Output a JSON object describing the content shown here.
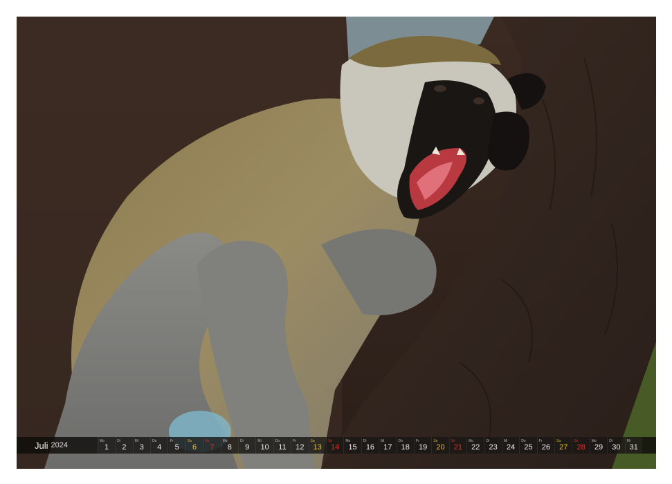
{
  "calendar": {
    "month": "Juli",
    "year": "2024",
    "days": [
      {
        "wd": "Mo",
        "num": "1",
        "kind": ""
      },
      {
        "wd": "Di",
        "num": "2",
        "kind": ""
      },
      {
        "wd": "Mi",
        "num": "3",
        "kind": ""
      },
      {
        "wd": "Do",
        "num": "4",
        "kind": ""
      },
      {
        "wd": "Fr",
        "num": "5",
        "kind": ""
      },
      {
        "wd": "Sa",
        "num": "6",
        "kind": "sa"
      },
      {
        "wd": "So",
        "num": "7",
        "kind": "su"
      },
      {
        "wd": "Mo",
        "num": "8",
        "kind": ""
      },
      {
        "wd": "Di",
        "num": "9",
        "kind": ""
      },
      {
        "wd": "Mi",
        "num": "10",
        "kind": ""
      },
      {
        "wd": "Do",
        "num": "11",
        "kind": ""
      },
      {
        "wd": "Fr",
        "num": "12",
        "kind": ""
      },
      {
        "wd": "Sa",
        "num": "13",
        "kind": "sa"
      },
      {
        "wd": "So",
        "num": "14",
        "kind": "su"
      },
      {
        "wd": "Mo",
        "num": "15",
        "kind": ""
      },
      {
        "wd": "Di",
        "num": "16",
        "kind": ""
      },
      {
        "wd": "Mi",
        "num": "17",
        "kind": ""
      },
      {
        "wd": "Do",
        "num": "18",
        "kind": ""
      },
      {
        "wd": "Fr",
        "num": "19",
        "kind": ""
      },
      {
        "wd": "Sa",
        "num": "20",
        "kind": "sa"
      },
      {
        "wd": "So",
        "num": "21",
        "kind": "su"
      },
      {
        "wd": "Mo",
        "num": "22",
        "kind": ""
      },
      {
        "wd": "Di",
        "num": "23",
        "kind": ""
      },
      {
        "wd": "Mi",
        "num": "24",
        "kind": ""
      },
      {
        "wd": "Do",
        "num": "25",
        "kind": ""
      },
      {
        "wd": "Fr",
        "num": "26",
        "kind": ""
      },
      {
        "wd": "Sa",
        "num": "27",
        "kind": "sa"
      },
      {
        "wd": "So",
        "num": "28",
        "kind": "su"
      },
      {
        "wd": "Mo",
        "num": "29",
        "kind": ""
      },
      {
        "wd": "Di",
        "num": "30",
        "kind": ""
      },
      {
        "wd": "Mi",
        "num": "31",
        "kind": ""
      }
    ]
  },
  "colors": {
    "saturday": "#f0c020",
    "sunday": "#e0302a",
    "bar_background": "#0f0c0a"
  },
  "photo": {
    "subject": "vervet-monkey-yawning-on-tree"
  }
}
